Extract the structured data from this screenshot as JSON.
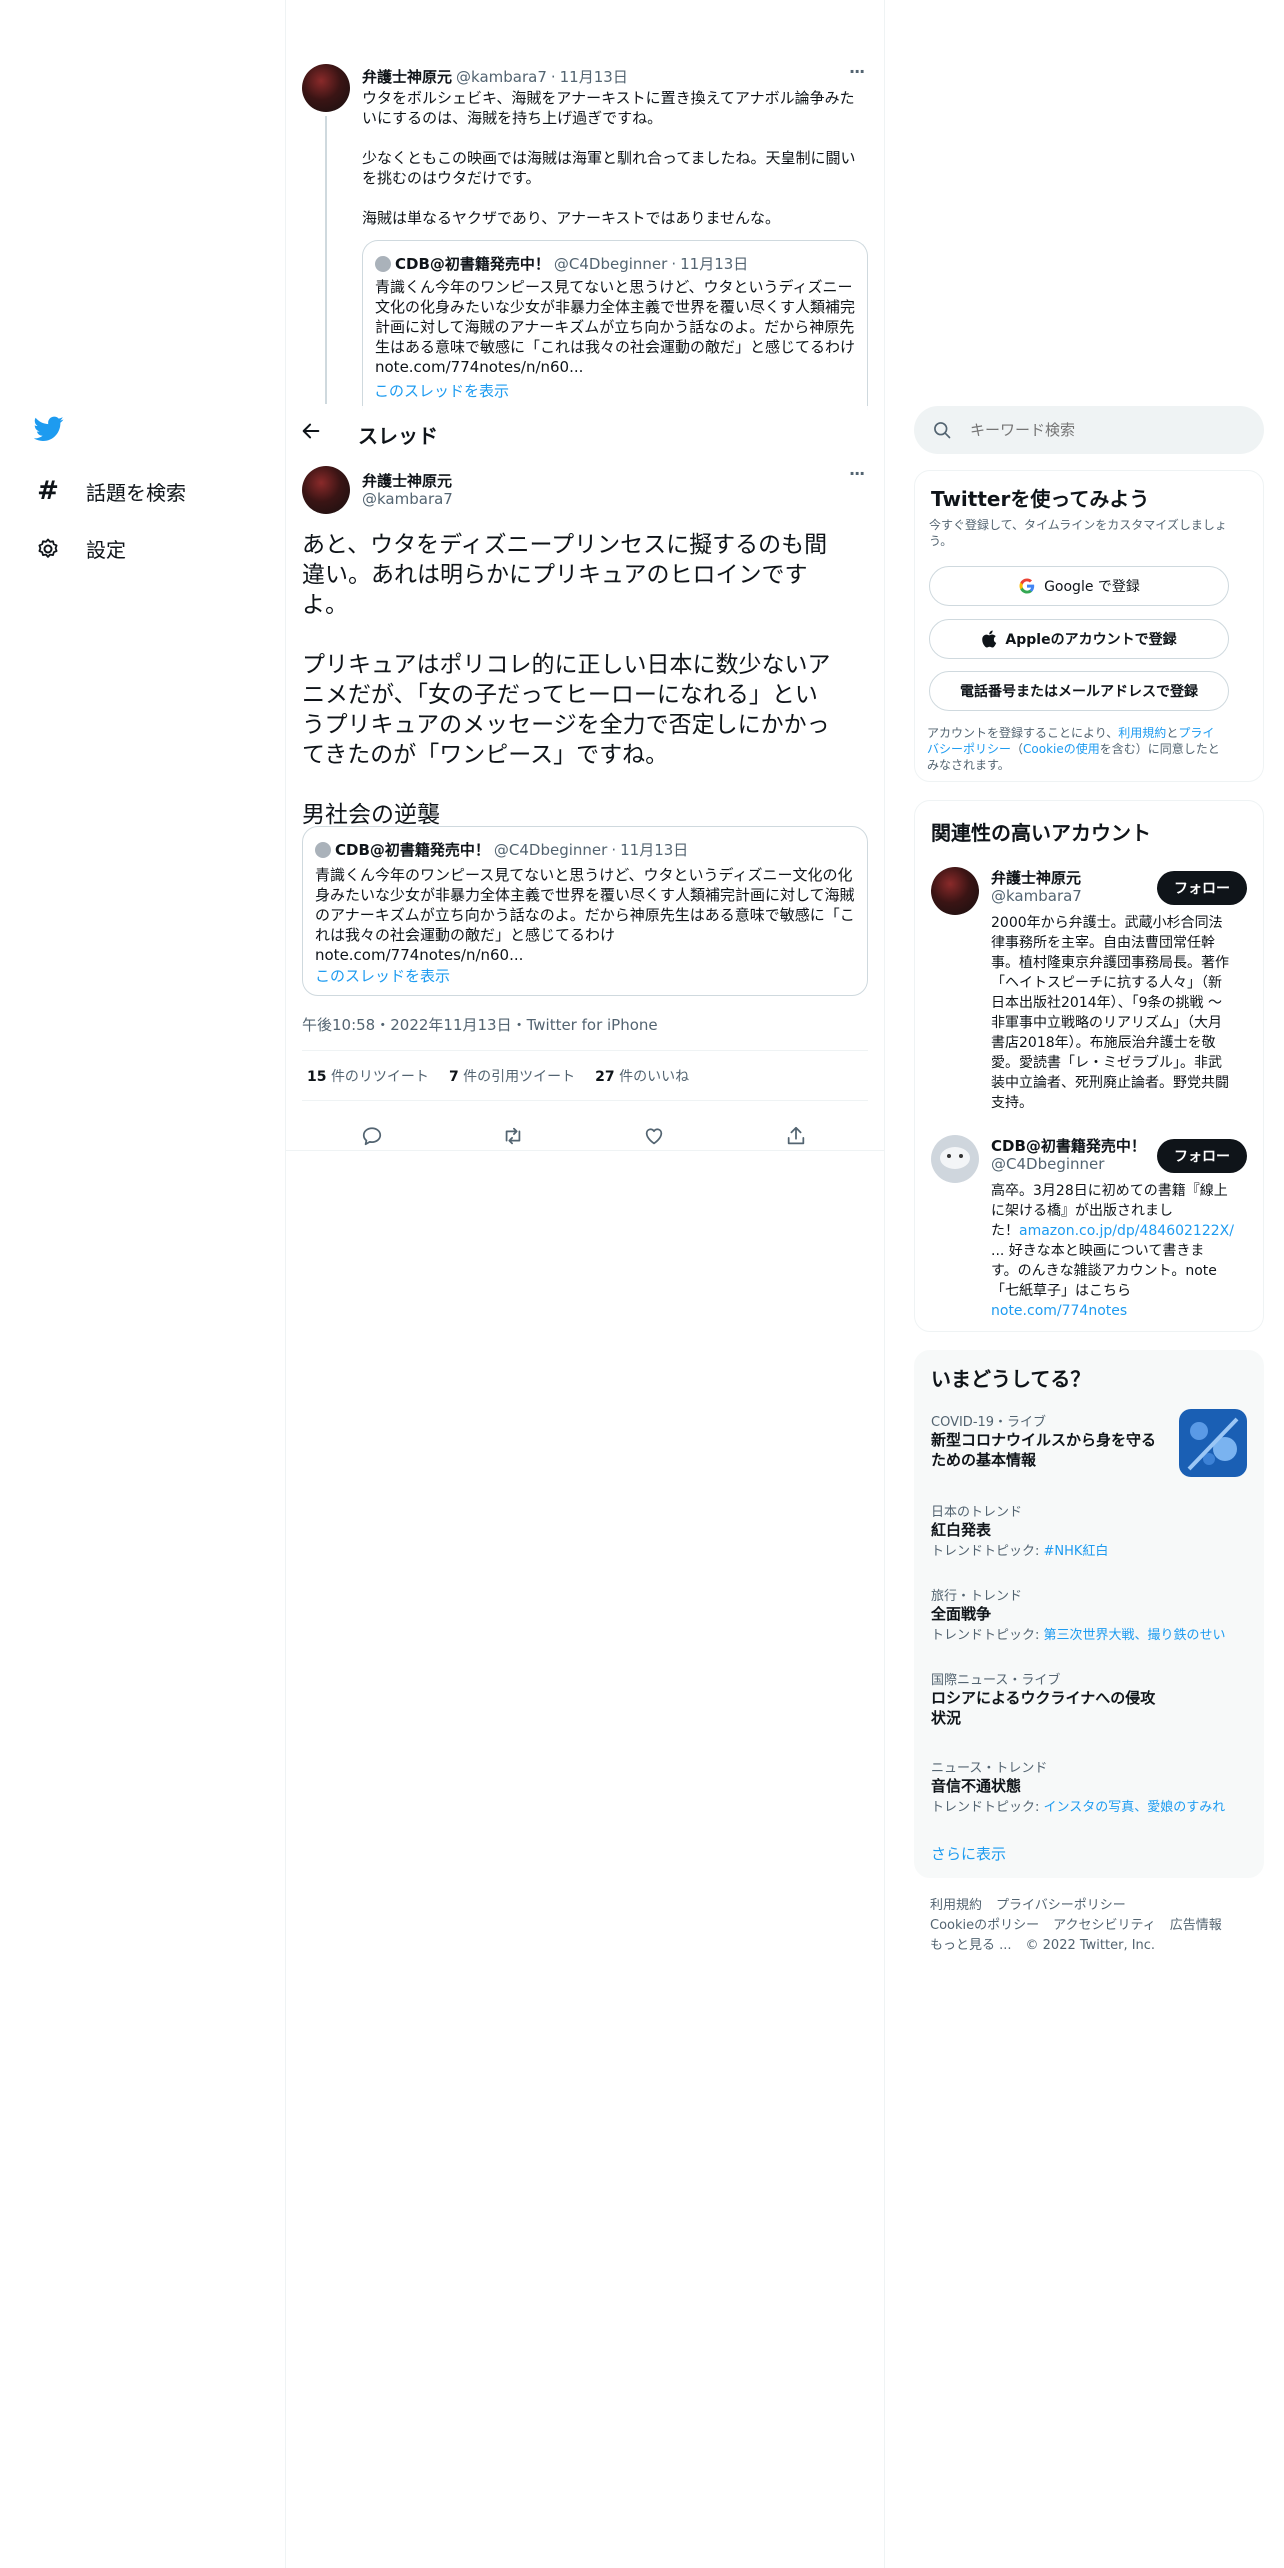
{
  "nav": {
    "explore_label": "話題を検索",
    "settings_label": "設定"
  },
  "thread_header": {
    "title": "スレッド"
  },
  "top_tweet": {
    "name": "弁護士神原元",
    "handle": "@kambara7",
    "date": "11月13日",
    "more": "···",
    "lines": [
      "ウタをボルシェビキ、海賊をアナーキストに置き換えてアナボル論争みた",
      "いにするのは、海賊を持ち上げ過ぎですね。",
      "",
      "少なくともこの映画では海賊は海軍と馴れ合ってましたね。天皇制に闘い",
      "を挑むのはウタだけです。",
      "",
      "海賊は単なるヤクザであり、アナーキストではありませんな。"
    ],
    "quote": {
      "name": "CDB@初書籍発売中！",
      "handle": "@C4Dbeginner",
      "date": "11月13日",
      "lines": [
        "青識くん今年のワンピース見てないと思うけど、ウタというディズニー",
        "文化の化身みたいな少女が非暴力全体主義で世界を覆い尽くす人類補完",
        "計画に対して海賊のアナーキズムが立ち向かう話なのよ。だから神原先",
        "生はある意味で敏感に「これは我々の社会運動の敵だ」と感じてるわけ",
        "note.com/774notes/n/n60..."
      ],
      "show_thread": "このスレッドを表示"
    }
  },
  "main_tweet": {
    "name": "弁護士神原元",
    "handle": "@kambara7",
    "more": "···",
    "lines": [
      "あと、ウタをディズニープリンセスに擬するのも間",
      "違い。あれは明らかにプリキュアのヒロインです",
      "よ。",
      "",
      "プリキュアはポリコレ的に正しい日本に数少ないア",
      "ニメだが、「女の子だってヒーローになれる」とい",
      "うプリキュアのメッセージを全力で否定しにかかっ",
      "てきたのが「ワンピース」ですね。",
      "",
      "男社会の逆襲"
    ],
    "quote": {
      "name": "CDB@初書籍発売中！",
      "handle": "@C4Dbeginner",
      "date": "11月13日",
      "lines": [
        "青識くん今年のワンピース見てないと思うけど、ウタというディズニー文化の化",
        "身みたいな少女が非暴力全体主義で世界を覆い尽くす人類補完計画に対して海賊",
        "のアナーキズムが立ち向かう話なのよ。だから神原先生はある意味で敏感に「こ",
        "れは我々の社会運動の敵だ」と感じてるわけ",
        "note.com/774notes/n/n60..."
      ],
      "show_thread": "このスレッドを表示"
    },
    "timestamp": "午後10:58・2022年11月13日・Twitter for iPhone",
    "stats": {
      "retweets_count": "15",
      "retweets_label": "件のリツイート",
      "quotes_count": "7",
      "quotes_label": "件の引用ツイート",
      "likes_count": "27",
      "likes_label": "件のいいね"
    }
  },
  "search": {
    "placeholder": "キーワード検索"
  },
  "signup": {
    "title": "Twitterを使ってみよう",
    "subtitle_lines": [
      "今すぐ登録して、タイムラインをカスタマイズしましょ",
      "う。"
    ],
    "google_label": "Google で登録",
    "apple_label": "Appleのアカウントで登録",
    "phone_label": "電話番号またはメールアドレスで登録",
    "terms_line1_pre": "アカウントを登録することにより、",
    "terms_tos": "利用規約",
    "terms_and": "と",
    "terms_privacy1": "プライ",
    "terms_privacy2": "バシーポリシー",
    "terms_mid": "（",
    "terms_cookie": "Cookieの使用",
    "terms_post": "を含む）に同意したと",
    "terms_line3": "みなされます。"
  },
  "relevant": {
    "title": "関連性の高いアカウント",
    "follow_label": "フォロー",
    "accounts": [
      {
        "name": "弁護士神原元",
        "handle": "@kambara7",
        "bio_lines": [
          "2000年から弁護士。武蔵小杉合同法",
          "律事務所を主宰。自由法曹団常任幹",
          "事。植村隆東京弁護団事務局長。著作",
          "「ヘイトスピーチに抗する人々」（新",
          "日本出版社2014年）、「9条の挑戦 ～",
          "非軍事中立戦略のリアリズム」（大月",
          "書店2018年）。布施辰治弁護士を敬",
          "愛。愛読書「レ・ミゼラブル」。非武",
          "装中立論者、死刑廃止論者。野党共闘",
          "支持。"
        ]
      },
      {
        "name": "CDB@初書籍発売中！",
        "handle": "@C4Dbeginner",
        "bio_lines": [
          "高卒。3月28日に初めての書籍『線上",
          "に架ける橋』が出版されまし",
          "た！"
        ],
        "bio_link": "amazon.co.jp/dp/484602122X/",
        "bio_lines2": [
          "... 好きな本と映画について書きま",
          "す。のんきな雑談アカウント。note",
          "「七紙草子」はこちら"
        ],
        "bio_link2": "note.com/774notes"
      }
    ]
  },
  "trends": {
    "title": "いまどうしてる？",
    "items": [
      {
        "context": "COVID-19・ライブ",
        "title_lines": [
          "新型コロナウイルスから身を守る",
          "ための基本情報"
        ],
        "sub_label": "",
        "sub_link": ""
      },
      {
        "context": "日本のトレンド",
        "title_lines": [
          "紅白発表"
        ],
        "sub_label": "トレンドトピック: ",
        "sub_link": "#NHK紅白"
      },
      {
        "context": "旅行・トレンド",
        "title_lines": [
          "全面戦争"
        ],
        "sub_label": "トレンドトピック: ",
        "sub_link": "第三次世界大戦、撮り鉄のせい"
      },
      {
        "context": "国際ニュース・ライブ",
        "title_lines": [
          "ロシアによるウクライナへの侵攻",
          "状況"
        ],
        "sub_label": "",
        "sub_link": ""
      },
      {
        "context": "ニュース・トレンド",
        "title_lines": [
          "音信不通状態"
        ],
        "sub_label": "トレンドトピック: ",
        "sub_link": "インスタの写真、愛娘のすみれ"
      }
    ],
    "show_more": "さらに表示"
  },
  "footer": {
    "line1": [
      "利用規約",
      "プライバシーポリシー"
    ],
    "line2": [
      "Cookieのポリシー",
      "アクセシビリティ",
      "広告情報"
    ],
    "more": "もっと見る ...",
    "copyright": "© 2022 Twitter, Inc."
  },
  "colors": {
    "accent": "#1d9bf0",
    "text": "#0f1419",
    "muted": "#536471",
    "border": "#eff3f4"
  }
}
